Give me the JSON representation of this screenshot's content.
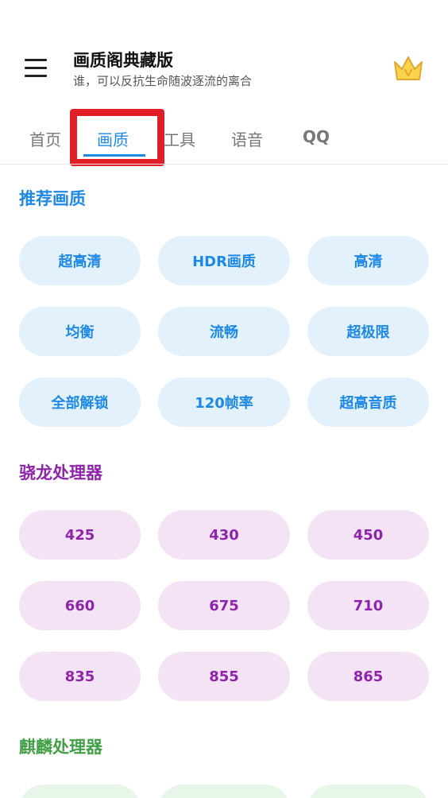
{
  "header": {
    "title": "画质阁典藏版",
    "subtitle": "谁，可以反抗生命随波逐流的离合"
  },
  "tabs": [
    {
      "label": "首页"
    },
    {
      "label": "画质"
    },
    {
      "label": "工具"
    },
    {
      "label": "语音"
    },
    {
      "label": "QQ"
    }
  ],
  "active_tab": "画质",
  "sections": {
    "recommended": {
      "title": "推荐画质",
      "color": "#1E88E5",
      "chips": [
        "超高清",
        "HDR画质",
        "高清",
        "均衡",
        "流畅",
        "超极限",
        "全部解锁",
        "120帧率",
        "超高音质"
      ]
    },
    "snapdragon": {
      "title": "骁龙处理器",
      "color": "#8E24AA",
      "chips": [
        "425",
        "430",
        "450",
        "660",
        "675",
        "710",
        "835",
        "855",
        "865"
      ]
    },
    "kirin": {
      "title": "麒麟处理器",
      "color": "#43A047"
    }
  },
  "icons": {
    "menu": "menu-icon",
    "crown": "crown-icon"
  },
  "colors": {
    "highlight_box": "#E21F26",
    "accent": "#1E88E5"
  }
}
